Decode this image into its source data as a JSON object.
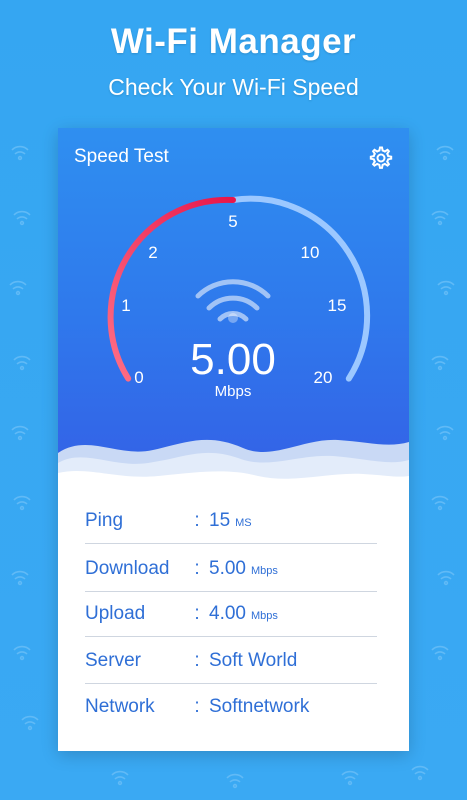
{
  "promo": {
    "title": "Wi-Fi Manager",
    "subtitle": "Check Your Wi-Fi Speed"
  },
  "app": {
    "title": "Speed Test",
    "settings_icon": "gear-icon"
  },
  "gauge": {
    "ticks": [
      "0",
      "1",
      "2",
      "5",
      "10",
      "15",
      "20"
    ],
    "value": "5.00",
    "unit": "Mbps",
    "progress_color": "#f0325e",
    "track_color": "#9cc8ff"
  },
  "stats": [
    {
      "label": "Ping",
      "colon": ":",
      "value": "15",
      "unit": "MS"
    },
    {
      "label": "Download",
      "colon": ":",
      "value": "5.00",
      "unit": "Mbps"
    },
    {
      "label": "Upload",
      "colon": ":",
      "value": "4.00",
      "unit": "Mbps"
    },
    {
      "label": "Server",
      "colon": ":",
      "value": "Soft World",
      "unit": ""
    },
    {
      "label": "Network",
      "colon": ":",
      "value": "Softnetwork",
      "unit": ""
    }
  ],
  "colors": {
    "background": "#35a6f2",
    "accent_text": "#2f6fd6"
  }
}
